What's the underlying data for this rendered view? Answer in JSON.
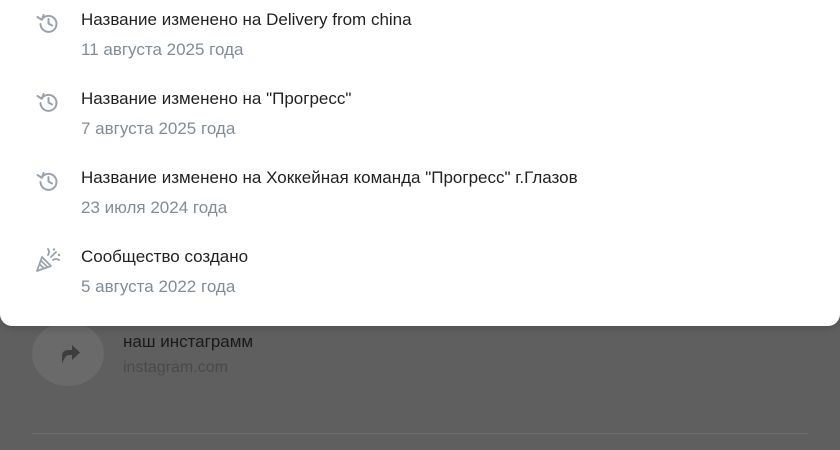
{
  "history": {
    "items": [
      {
        "icon": "history-icon",
        "title": "Название изменено на Delivery from china",
        "date": "11 августа 2025 года"
      },
      {
        "icon": "history-icon",
        "title": "Название изменено на \"Прогресс\"",
        "date": "7 августа 2025 года"
      },
      {
        "icon": "history-icon",
        "title": "Название изменено на Хоккейная команда \"Прогресс\" г.Глазов",
        "date": "23 июля 2024 года"
      },
      {
        "icon": "party-popper-icon",
        "title": "Сообщество создано",
        "date": "5 августа 2022 года"
      }
    ]
  },
  "background": {
    "link": {
      "icon": "share-arrow-icon",
      "title": "наш инстаграмм",
      "domain": "instagram.com"
    }
  },
  "colors": {
    "overlay": "#5f5f5f",
    "popup_bg": "#ffffff",
    "text_primary": "#222222",
    "text_secondary": "#818c99",
    "icon": "#99a2ad"
  }
}
